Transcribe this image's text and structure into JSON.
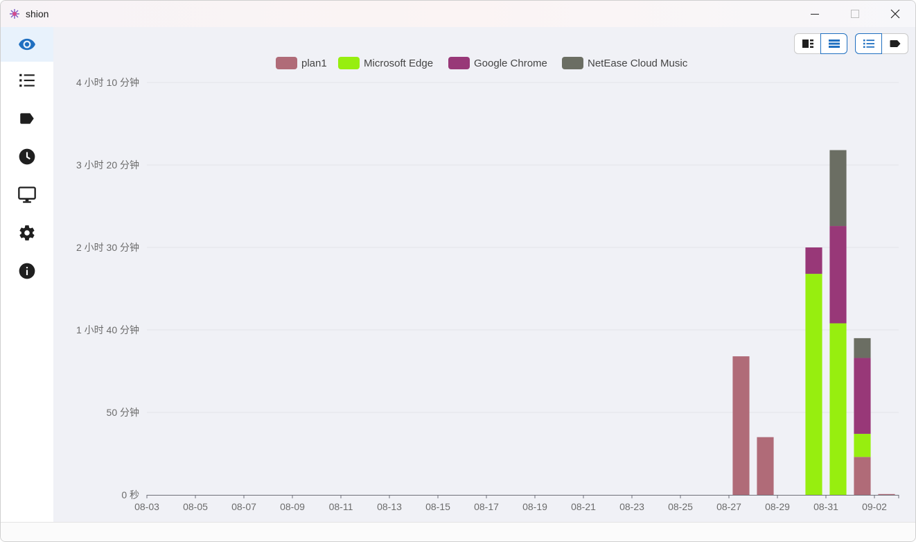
{
  "window": {
    "title": "shion",
    "controls": {
      "minimize": "minimize",
      "maximize": "maximize",
      "close": "close"
    }
  },
  "sidebar": {
    "items": [
      {
        "icon": "eye-icon",
        "active": true
      },
      {
        "icon": "list-icon",
        "active": false
      },
      {
        "icon": "tag-icon",
        "active": false
      },
      {
        "icon": "clock-icon",
        "active": false
      },
      {
        "icon": "monitor-icon",
        "active": false
      },
      {
        "icon": "gear-icon",
        "active": false
      },
      {
        "icon": "info-icon",
        "active": false
      }
    ]
  },
  "toolbar": {
    "layout_group": [
      {
        "icon": "split-view-icon",
        "selected": false
      },
      {
        "icon": "stacked-view-icon",
        "selected": true
      }
    ],
    "mode_group": [
      {
        "icon": "list-mode-icon",
        "selected": true
      },
      {
        "icon": "tag-mode-icon",
        "selected": false
      }
    ],
    "accent": "#1f6fc0"
  },
  "chart_data": {
    "type": "bar",
    "stacked": true,
    "legend_position": "top",
    "grid": true,
    "y_tick_labels": [
      "0 秒",
      "50 分钟",
      "1 小时 40 分钟",
      "2 小时 30 分钟",
      "3 小时 20 分钟",
      "4 小时 10 分钟"
    ],
    "y_ticks_minutes": [
      0,
      50,
      100,
      150,
      200,
      250
    ],
    "ylim_minutes": [
      0,
      250
    ],
    "categories": [
      "08-03",
      "08-04",
      "08-05",
      "08-06",
      "08-07",
      "08-08",
      "08-09",
      "08-10",
      "08-11",
      "08-12",
      "08-13",
      "08-14",
      "08-15",
      "08-16",
      "08-17",
      "08-18",
      "08-19",
      "08-20",
      "08-21",
      "08-22",
      "08-23",
      "08-24",
      "08-25",
      "08-26",
      "08-27",
      "08-28",
      "08-29",
      "08-30",
      "08-31",
      "09-01",
      "09-02"
    ],
    "x_tick_labels": [
      "08-03",
      "08-05",
      "08-07",
      "08-09",
      "08-11",
      "08-13",
      "08-15",
      "08-17",
      "08-19",
      "08-21",
      "08-23",
      "08-25",
      "08-27",
      "08-29",
      "08-31",
      "09-02"
    ],
    "series": [
      {
        "name": "plan1",
        "color": "#b06b78",
        "values": [
          0,
          0,
          0,
          0,
          0,
          0,
          0,
          0,
          0,
          0,
          0,
          0,
          0,
          0,
          0,
          0,
          0,
          0,
          0,
          0,
          0,
          0,
          0,
          0,
          84,
          35,
          0,
          0,
          0,
          23,
          0.5
        ]
      },
      {
        "name": "Microsoft Edge",
        "color": "#97ee0f",
        "values": [
          0,
          0,
          0,
          0,
          0,
          0,
          0,
          0,
          0,
          0,
          0,
          0,
          0,
          0,
          0,
          0,
          0,
          0,
          0,
          0,
          0,
          0,
          0,
          0,
          0,
          0,
          0,
          134,
          104,
          14,
          0
        ]
      },
      {
        "name": "Google Chrome",
        "color": "#983878",
        "values": [
          0,
          0,
          0,
          0,
          0,
          0,
          0,
          0,
          0,
          0,
          0,
          0,
          0,
          0,
          0,
          0,
          0,
          0,
          0,
          0,
          0,
          0,
          0,
          0,
          0,
          0,
          0,
          16,
          59,
          46,
          0
        ]
      },
      {
        "name": "NetEase Cloud Music",
        "color": "#6b6e63",
        "values": [
          0,
          0,
          0,
          0,
          0,
          0,
          0,
          0,
          0,
          0,
          0,
          0,
          0,
          0,
          0,
          0,
          0,
          0,
          0,
          0,
          0,
          0,
          0,
          0,
          0,
          0,
          0,
          0,
          46,
          12,
          0
        ]
      }
    ]
  }
}
